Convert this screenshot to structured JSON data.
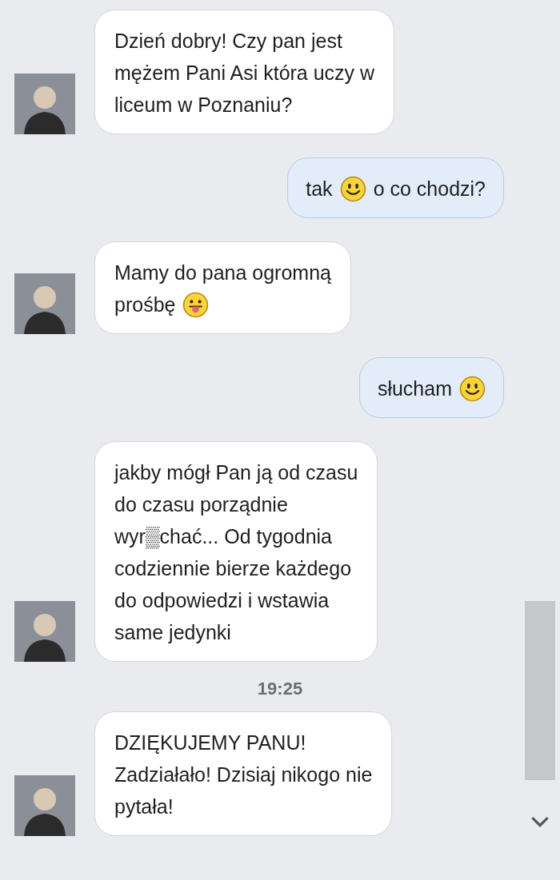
{
  "messages": [
    {
      "kind": "incoming",
      "lines": [
        [
          {
            "kind": "text",
            "text": "Dzień dobry! Czy pan jest"
          }
        ],
        [
          {
            "kind": "text",
            "text": "mężem Pani Asi która uczy w"
          }
        ],
        [
          {
            "kind": "text",
            "text": "liceum w Poznaniu?"
          }
        ]
      ]
    },
    {
      "kind": "outgoing",
      "lines": [
        [
          {
            "kind": "text",
            "text": "tak"
          },
          {
            "kind": "smiley"
          },
          {
            "kind": "text",
            "text": "o co chodzi?"
          }
        ]
      ]
    },
    {
      "kind": "incoming",
      "lines": [
        [
          {
            "kind": "text",
            "text": "Mamy do pana ogromną"
          }
        ],
        [
          {
            "kind": "text",
            "text": "prośbę"
          },
          {
            "kind": "tongue"
          }
        ]
      ]
    },
    {
      "kind": "outgoing",
      "lines": [
        [
          {
            "kind": "text",
            "text": "słucham"
          },
          {
            "kind": "smiley"
          }
        ]
      ]
    },
    {
      "kind": "incoming",
      "lines": [
        [
          {
            "kind": "text",
            "text": "jakby mógł Pan ją od czasu"
          }
        ],
        [
          {
            "kind": "text",
            "text": "do czasu porządnie"
          }
        ],
        [
          {
            "kind": "text",
            "text": "wyr▒chać... Od tygodnia"
          }
        ],
        [
          {
            "kind": "text",
            "text": "codziennie bierze każdego"
          }
        ],
        [
          {
            "kind": "text",
            "text": "do odpowiedzi i wstawia"
          }
        ],
        [
          {
            "kind": "text",
            "text": "same jedynki"
          }
        ]
      ]
    },
    {
      "kind": "time",
      "text": "19:25"
    },
    {
      "kind": "incoming",
      "lines": [
        [
          {
            "kind": "text",
            "text": "DZIĘKUJEMY PANU!"
          }
        ],
        [
          {
            "kind": "text",
            "text": "Zadziałało! Dzisiaj nikogo nie"
          }
        ],
        [
          {
            "kind": "text",
            "text": "pytała!"
          }
        ]
      ]
    }
  ]
}
